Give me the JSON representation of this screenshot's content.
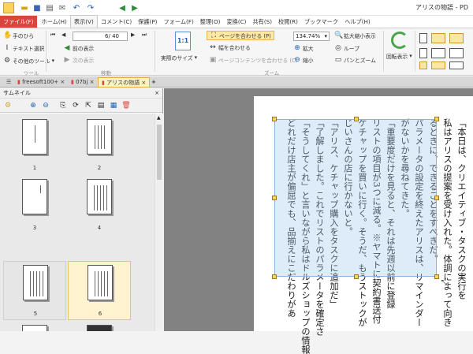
{
  "window": {
    "title": "アリスの物語 - PD"
  },
  "quick_access": [
    "folder-icon",
    "save-icon",
    "print-icon",
    "mail-icon",
    "undo-icon",
    "redo-icon",
    "back-icon",
    "forward-icon"
  ],
  "menu": {
    "file": "ファイル(F)",
    "items": [
      "ホーム(H)",
      "表示(V)",
      "コメント(C)",
      "保護(P)",
      "フォーム(F)",
      "整理(O)",
      "変換(C)",
      "共有(S)",
      "校閲(R)",
      "ブックマーク",
      "ヘルプ(H)"
    ],
    "active": "表示(V)"
  },
  "ribbon": {
    "tools": {
      "hand": "手のひら",
      "text_select": "テキスト選択",
      "other_tools": "その他のツール",
      "group": "ツール"
    },
    "move": {
      "page_value": "6/ 40",
      "prev": "前の表示",
      "next": "次の表示",
      "group": "移動"
    },
    "zoom": {
      "actual_size": "実際のサイズ",
      "fit_page": "ページを合わせる (P)",
      "fit_width": "幅を合わせる",
      "fit_content": "ページコンテンツを合わせる (C)",
      "zoom_value": "134.74%",
      "zoom_in": "拡大",
      "zoom_out": "縮小",
      "group": "ズーム"
    },
    "view": {
      "magnifier": "拡大縮小表示",
      "loupe": "ループ",
      "pan_zoom": "パンとズーム",
      "rotate": "回転表示"
    }
  },
  "tabs": [
    "freesoft100+",
    "07bj",
    "アリスの物語"
  ],
  "panel": {
    "title": "サムネイル",
    "pages": [
      "1",
      "2",
      "3",
      "4",
      "5",
      "6"
    ],
    "selected": "6"
  },
  "document": {
    "columns": [
      "「本日は、クリエイティブ・タスクの実行を",
      "私はアリスの提案を受け入れた。体調によって向き",
      "るときに、できることをすべきだ。",
      "パラメータの設定を終えたアリスは、リマインダー",
      "がないかを尋ねてきた。",
      "「重要度だけを見ると、それは先週以前に登録",
      "リストの項目が3つに減る。※ヤマトに契約書送付",
      "ケチャップを買いに行く。そうだ、もうストックが",
      "じいさんの店に行かないと。",
      "「アリス、ケチャップ購入をタスクに追加だ」",
      "「了解しました。これでリストのパラメータを確定さ",
      "「そうしてくれ」と言いながら私はドルズショップの情報",
      "どれだけ店主が偏屈でも、品揃えにこだわりがあ"
    ]
  }
}
